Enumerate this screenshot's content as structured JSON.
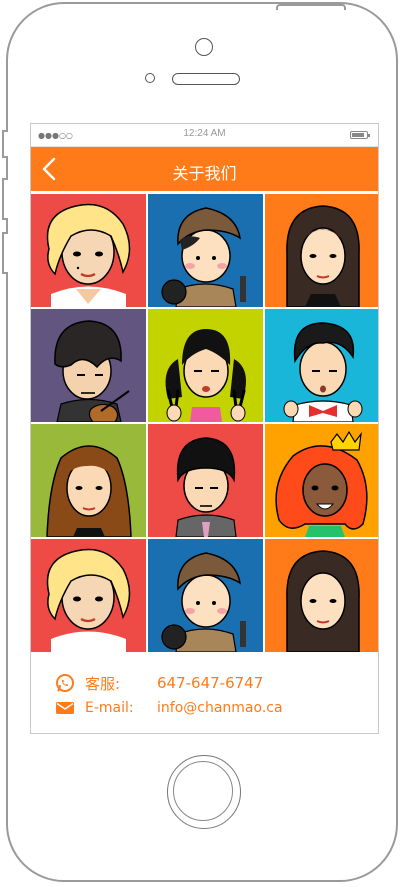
{
  "status_bar": {
    "signal": "●●●○○",
    "time": "12:24 AM"
  },
  "nav": {
    "title": "关于我们",
    "back_icon": "chevron-left-icon"
  },
  "colors": {
    "accent": "#ff7b19",
    "tiles": [
      "#ef4b46",
      "#1a6fb0",
      "#ff7b19",
      "#625680",
      "#c3d300",
      "#19b6d9",
      "#98b93a",
      "#ef4b46",
      "#ffa200",
      "#ef4b46",
      "#1a6fb0",
      "#ff7b19"
    ]
  },
  "avatars": [
    {
      "name": "avatar-blonde-woman",
      "bg": "#ef4b46"
    },
    {
      "name": "avatar-man-flat-cap-pan",
      "bg": "#1a6fb0"
    },
    {
      "name": "avatar-woman-dark-hair",
      "bg": "#ff7b19"
    },
    {
      "name": "avatar-man-violin",
      "bg": "#625680"
    },
    {
      "name": "avatar-girl-pigtails-peace",
      "bg": "#c3d300"
    },
    {
      "name": "avatar-man-bow-tie",
      "bg": "#19b6d9"
    },
    {
      "name": "avatar-woman-brown-hair",
      "bg": "#98b93a"
    },
    {
      "name": "avatar-man-bowl-cut-tie",
      "bg": "#ef4b46"
    },
    {
      "name": "avatar-woman-red-hair-crown",
      "bg": "#ffa200"
    },
    {
      "name": "avatar-blonde-woman-2",
      "bg": "#ef4b46"
    },
    {
      "name": "avatar-man-flat-cap-pan-2",
      "bg": "#1a6fb0"
    },
    {
      "name": "avatar-woman-dark-hair-2",
      "bg": "#ff7b19"
    }
  ],
  "contact": {
    "service_icon": "whatsapp-chat-icon",
    "service_label": "客服:",
    "service_value": "647-647-6747",
    "email_icon": "envelope-icon",
    "email_label": "E-mail:",
    "email_value": "info@chanmao.ca"
  }
}
